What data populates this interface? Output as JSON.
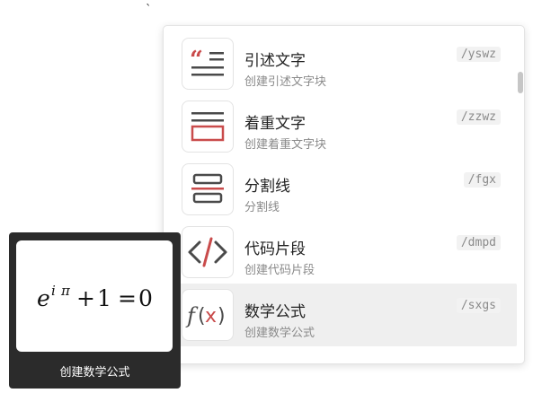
{
  "stray_mark": "`",
  "colors": {
    "accent_red": "#c94b4b",
    "icon_dark": "#4a4a4a",
    "active_item_bg": "#efefef"
  },
  "menu": {
    "items": [
      {
        "icon": "quote-icon",
        "title": "引述文字",
        "description": "创建引述文字块",
        "shortcut": "/yswz"
      },
      {
        "icon": "emphasis-block-icon",
        "title": "着重文字",
        "description": "创建着重文字块",
        "shortcut": "/zzwz"
      },
      {
        "icon": "divider-icon",
        "title": "分割线",
        "description": "分割线",
        "shortcut": "/fgx"
      },
      {
        "icon": "code-icon",
        "title": "代码片段",
        "description": "创建代码片段",
        "shortcut": "/dmpd"
      },
      {
        "icon": "function-icon",
        "title": "数学公式",
        "description": "创建数学公式",
        "shortcut": "/sxgs",
        "active": true
      }
    ]
  },
  "preview": {
    "formula": "e^{i π} + 1 = 0",
    "caption": "创建数学公式"
  }
}
